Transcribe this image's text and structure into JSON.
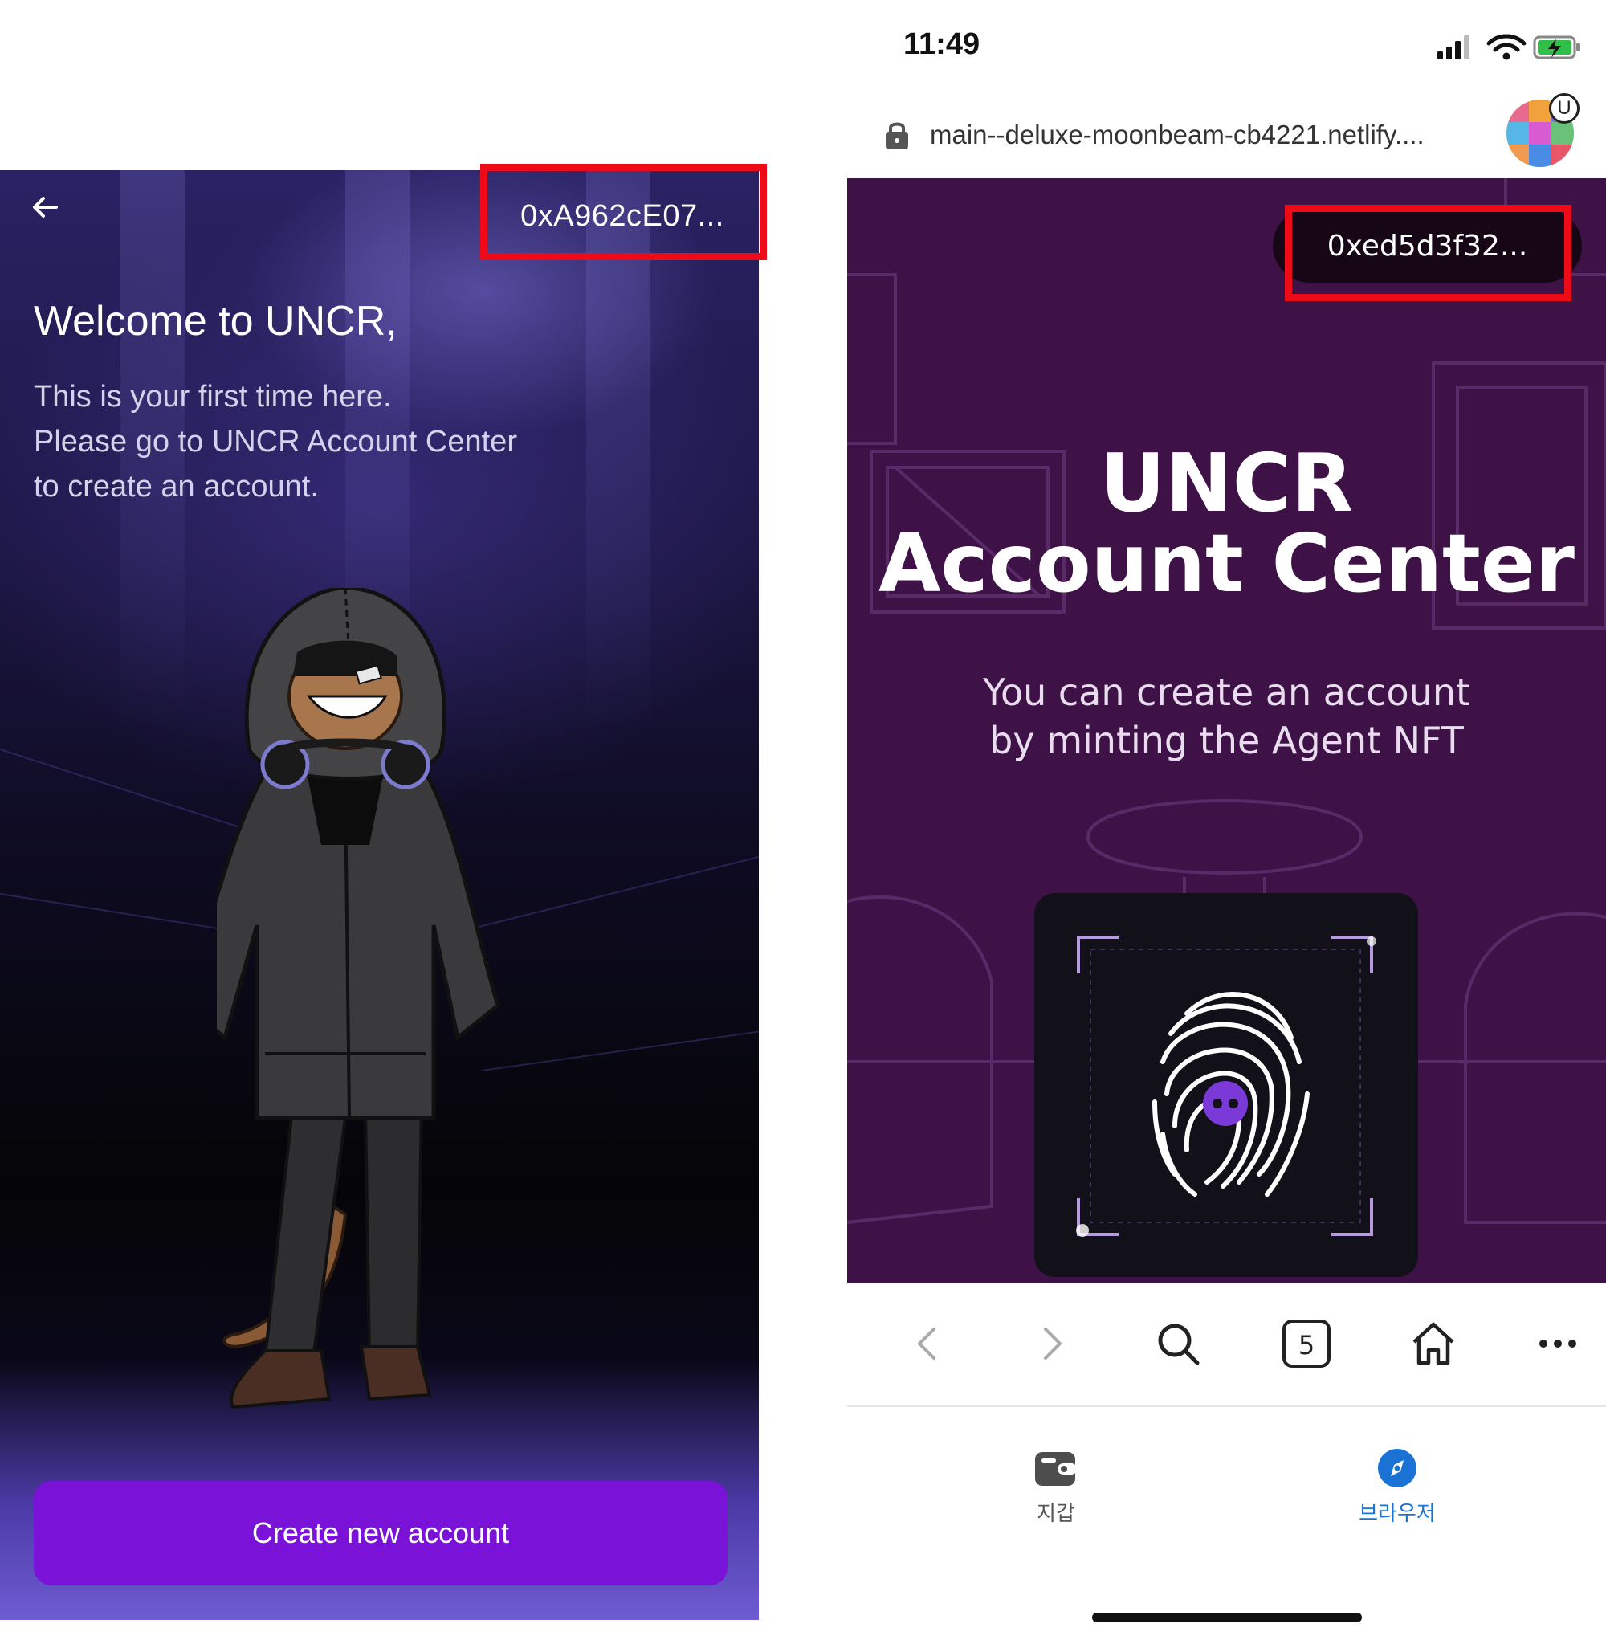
{
  "left_screen": {
    "address": "0xA962cE07...",
    "welcome_title": "Welcome to UNCR,",
    "description_lines": [
      "This is your first time here.",
      "Please go to UNCR Account Center",
      "to create an account."
    ],
    "create_button_label": "Create new account",
    "colors": {
      "button": "#7a12d8",
      "highlight": "#ec0b16"
    }
  },
  "right_screen": {
    "status_bar": {
      "time": "11:49"
    },
    "browser": {
      "url": "main--deluxe-moonbeam-cb4221.netlify....",
      "profile_badge": "U",
      "tab_count": "5"
    },
    "page": {
      "address": "0xed5d3f32...",
      "title_line1": "UNCR",
      "title_line2": "Account Center",
      "subtitle_line1": "You can create an account",
      "subtitle_line2": "by minting the Agent NFT"
    },
    "bottom_tabs": [
      {
        "label": "지갑",
        "icon": "wallet-icon",
        "active": false
      },
      {
        "label": "브라우저",
        "icon": "compass-icon",
        "active": true
      }
    ],
    "colors": {
      "page_bg": "#3e1247",
      "active_tab": "#1a73d4",
      "inactive_tab": "#555555"
    }
  }
}
